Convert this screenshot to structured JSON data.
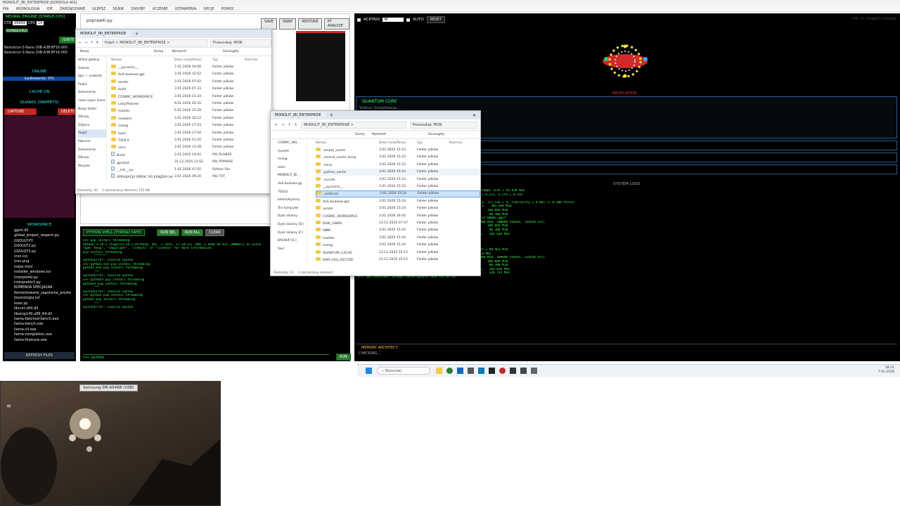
{
  "window": {
    "title": "MONOLIT_IBI_ENTERPRISE [KONSOLA AGI]"
  },
  "menu": [
    "Plik",
    "KRONOLOGIA",
    "IDE",
    "ZARZĄDZANIE",
    "ULEPSZ",
    "SILNIK",
    "ZASOBY",
    "UCZENIE",
    "USTAWIENIA",
    "OPCJE",
    "POMOC"
  ],
  "left_panel": {
    "engine_title": "NEURAL ENGINE [STABLE-CPU]",
    "ctx_label": "CTX",
    "ctx_value": "99999",
    "cpu_label": "CPU",
    "cpu_value": "16",
    "model_badge": "[STABLE-CPU]",
    "ignite_label": "IGNITE",
    "models": [
      "Nemotron-3-Nano-30B-A3B-BF16-000",
      "Nemotron-3-Nano-30B-A3B-BF16-000"
    ],
    "online": "ONLINE",
    "loading": "Ładowanie: 0%",
    "cache_on": "CACHE ON",
    "quarks_title": "QUARKS (SNIPPETS)",
    "capture": "CAPTURE",
    "delete": "DELETE",
    "workspace_title": "WORKSPACE",
    "files": [
      "ggml.dll",
      "global_project_respect.py",
      "GSOULF.PY",
      "GSOULF2.py",
      "GSOULF3.py",
      "icon.ico",
      "icon.png",
      "index.html",
      "installer_windows.iss",
      "interpretel.py",
      "interpreter1.py",
      "KOMENDA SPECJALNA",
      "Komentowane_zapytania_proste",
      "kosmologia.txt",
      "lexer.py",
      "libcurl-x64.dll",
      "libomp140.x86_64.dll",
      "llama-batched-bench.exe",
      "llama-bench.exe",
      "llama-cli.exe",
      "llama-completion.exe",
      "llama-finetune.exe"
    ],
    "refresh": "REFRESH FILES"
  },
  "editor": {
    "file": "poprawki.py",
    "buttons": [
      "SAVE",
      "SWAP",
      "RESTORE",
      "PY ANALYZE"
    ]
  },
  "python_shell": {
    "title": "PYTHON SHELL [THREAD SAFE]",
    "buttons": [
      "RUN SEL",
      "RUN ALL",
      "CLEAR"
    ],
    "lines": [
      ">>> pip install threading",
      "Python 3.14.2 (tags/v3.14.2:df79316, Dec  5 2025, 17:18:21) [MSC v.1944 64 bit (AMD64)] on win32",
      "Type \"help\", \"copyright\", \"credits\" or \"license\" for more information.",
      "pip install threading",
      "      ^^^^^^^",
      "SyntaxError: invalid syntax",
      ">>> python.exe pip install threading",
      "python.exe pip install threading",
      "      ^^^",
      "SyntaxError: invalid syntax",
      ">>> python3 pip install threading",
      "python3 pip install threading",
      "      ^^^",
      "SyntaxError: invalid syntax",
      ">>> python pip install threading",
      "python pip install threading",
      "      ^^^",
      "SyntaxError: invalid syntax"
    ],
    "prompt": ">>> python",
    "run": "RUN"
  },
  "explorer1": {
    "tab": "MONOLIT_IBI_ENTERPRISE",
    "path": [
      "Pulpit",
      ">",
      "MONOLIT_IBI_ENTERPRISE",
      ">"
    ],
    "search": "Przeszukaj: MON",
    "toolbar": [
      "Nowy",
      "Sortuj",
      "Wyświetl",
      "Szczegóły"
    ],
    "nav": [
      "Widok główny",
      "Galeria",
      "Igor — osobiste",
      "Pulpit",
      "Dokumenty",
      "nowa super ikona",
      "Nowy folder",
      "Obrazy",
      "Zdjęcia",
      "Pulpit",
      "Pobrane",
      "Dokumenty",
      "Obrazy",
      "Muzyka"
    ],
    "columns": [
      "Nazwa",
      "Data modyfikacji",
      "Typ",
      "Rozmiar"
    ],
    "rows": [
      [
        "__pycache__",
        "7.01.2026 14:00",
        "Folder plików",
        ""
      ],
      [
        "AoS-budowa-gpt",
        "3.01.2026 15:52",
        "Folder plików",
        ""
      ],
      [
        "assets",
        "3.01.2026 07:02",
        "Folder plików",
        ""
      ],
      [
        "build",
        "3.01.2026 07:33",
        "Folder plików",
        ""
      ],
      [
        "COSMIC_WORKSPACE",
        "3.01.2026 15:24",
        "Folder plików",
        ""
      ],
      [
        "Listy/Pakiete",
        "6.01.2026 20:35",
        "Folder plików",
        ""
      ],
      [
        "models",
        "6.01.2026 15:29",
        "Folder plików",
        ""
      ],
      [
        "modules",
        "3.01.2026 16:12",
        "Folder plików",
        ""
      ],
      [
        "mxlog",
        "3.01.2026 17:03",
        "Folder plików",
        ""
      ],
      [
        "tools",
        "3.01.2026 17:04",
        "Folder plików",
        ""
      ],
      [
        "TOOLS",
        "3.01.2026 13:20",
        "Folder plików",
        ""
      ],
      [
        "venv",
        "3.01.2026 13:28",
        "Folder plików",
        ""
      ],
      [
        "Build",
        "3.01.2026 14:02",
        "Plik PLANER",
        ""
      ],
      [
        "gpustat",
        "31.12.2025 13:52",
        "Plik PYMAIRE",
        ""
      ],
      [
        "__init__.py",
        "1.01.2026 07:55",
        "Python File",
        ""
      ],
      [
        "APPLIKACJA OPRAC PO KSIĄŻKA.txt",
        "3.01.2026 09:20",
        "Plik TXT",
        ""
      ]
    ],
    "status": [
      "Elementy: 50",
      "1 zaznaczony element: 723 KB"
    ]
  },
  "explorer2": {
    "tab": "MONOLIT_IBI_ENTERPRISE",
    "path": [
      "MONOLIT_IBI_ENTERPRISE",
      ">"
    ],
    "search": "Przeszukaj: MON",
    "toolbar": [
      "Sortuj",
      "Wyświetl",
      "Szczegóły"
    ],
    "nav": [
      "COSMIC_WO...",
      "models",
      "mxlog",
      "tools",
      "MONOLIT_IB...",
      "AoS-budowa-gp",
      "TOOLS",
      "bled-katylomy",
      "Ten komputer",
      "Dysk lokalny",
      "Dysk lokalny (D:)",
      "Dysk lokalny (F:)",
      "BACKUP (E:)",
      "Sieć"
    ],
    "columns": [
      "Nazwa",
      "Data modyfikacji",
      "Typ",
      "Rozmiar"
    ],
    "rows": [
      [
        ".empty_cache",
        "3.01.2026 15:23",
        "Folder plików"
      ],
      [
        ".mistral_cache_temp",
        "3.01.2026 15:23",
        "Folder plików"
      ],
      [
        ".mirai",
        "3.01.2026 15:23",
        "Folder plików"
      ],
      [
        ".python_cache",
        "3.01.2026 15:23",
        "Folder plików"
      ],
      [
        ".vscode",
        "3.01.2026 15:23",
        "Folder plików"
      ],
      [
        "__pycache__",
        "3.01.2026 15:23",
        "Folder plików"
      ],
      [
        "_external",
        "3.01.2026 15:24",
        "Folder plików"
      ],
      [
        "AoS-budowa-gpt",
        "3.01.2026 15:24",
        "Folder plików"
      ],
      [
        "assets",
        "3.01.2026 15:24",
        "Folder plików"
      ],
      [
        "COSMIC_WORKSPACE",
        "3.01.2026 16:42",
        "Folder plików"
      ],
      [
        "DISK_GWAR",
        "23.12.2025 07:47",
        "Folder plików"
      ],
      [
        "INNR",
        "3.01.2026 15:24",
        "Folder plików"
      ],
      [
        "models",
        "3.01.2026 15:24",
        "Folder plików"
      ],
      [
        "mxlog",
        "3.01.2026 15:24",
        "Folder plików"
      ],
      [
        "QUANTUM_CACHE",
        "23.12.2025 15:15",
        "Folder plików"
      ],
      [
        "RAM_VGA_SECTOR",
        "23.12.2025 15:15",
        "Folder plików"
      ]
    ],
    "status": [
      "Elementy: 11",
      "1 zaznaczony element"
    ]
  },
  "right_panel": {
    "acktrix": "ACKTRIX",
    "acktrix_value": "W",
    "auto": "AUTO",
    "reset": "RESET",
    "header_right": "FPS: 27 | RENDER: CACHED",
    "revelation": "REVELATION",
    "quantum_core": "QUANTUM CORE",
    "status": "Status: Inicjalizacja...",
    "system_logs": "SYSTEM LOGS",
    "logs": [
      "                              slot update_slots: id  0 | task 0 | prompt size = 91,918 MiB",
      "                              cache_tokens.size() = 9,347, pos_min = 0,111, n_ctx = 8,192",
      "srv  params_from_: Chat format: Hermes 2 Pro",
      "slot get_availabl: id  0 | task -1 | selected slot by lcs similarity, lcs_len = 4, similarity = 0.002 (> 0.100 thold)",
      "srv  update: - prompt 0000000000000000: 8,192 tokens, checkpoints: 1,   305.469 MiB",
      "srv  update: - prompt 0000000000000000: 631 tokens, checkpoints: 1,   108.869 MiB",
      "srv  update: - prompt 0000000000000000: 231 tokens, checkpoints: 1,    90.300 MiB",
      "",
      "srv  load_model: loading model Nemotron-3-Nano-30B-A3B-BF16-000001-of-00002.gguf",
      "",
      "",
      "",
      "",
      "srv  update: - cache state: 5 prompts, 4321.018 MiB (limits: 8192.000 MiB, 100096 tokens, 116558 est)",
      "srv  update: - prompt 0000000000000000: 631 tokens, checkpoints: 1,   108.869 MiB",
      "srv  update: - prompt 0000000000000000: 231 tokens, checkpoints: 1,    90.300 MiB",
      "srv  update: - prompt 0000000000000000: 3741 tokens, checkpoints: 1,   164.628 MiB",
      "srv  log_server_r: request: POST /completion 127.0.0.1 200",
      "srv  loading: Nemotron-3-Nano-30B-A3B-BF16-00001-of-00002.gguf",
      "srv  operator(): cleaning up before exit...",
      "srv  prompt_save: - saving prompt with length 7001, total state size = 98.463 MiB",
      "srv  load: - looking for better prompt, base f_keep = 0.996, sim = 0.903",
      "srv  update: - cache state: 5 prompts, 4321.018 MiB (limits: 8192.000 MiB, 100096 tokens, 116558 est)",
      "srv  update: - prompt 0000000000000000: 631 tokens, checkpoints: 1,   108.869 MiB",
      "srv  update: - prompt 0000000000000000: 231 tokens, checkpoints: 1,    90.300 MiB",
      "srv  update: - prompt 0000000000000000: 3741 tokens, checkpoints: 1,   164.628 MiB",
      "srv  update: - prompt 0000000000000000: 7001 tokens, checkpoints: 1,   128.723 MiB",
      "srv  get_availabl: prompt cache update took 145.05 ms"
    ],
    "memory_title": "MEMORY ARCHITECT",
    "memory_status": "CHECKING..."
  },
  "taskbar": {
    "search": "Wyszukaj",
    "time": "18:51",
    "date": "7.01.2026"
  },
  "camera": {
    "label": "Samsung SM-A546B (USB)"
  }
}
